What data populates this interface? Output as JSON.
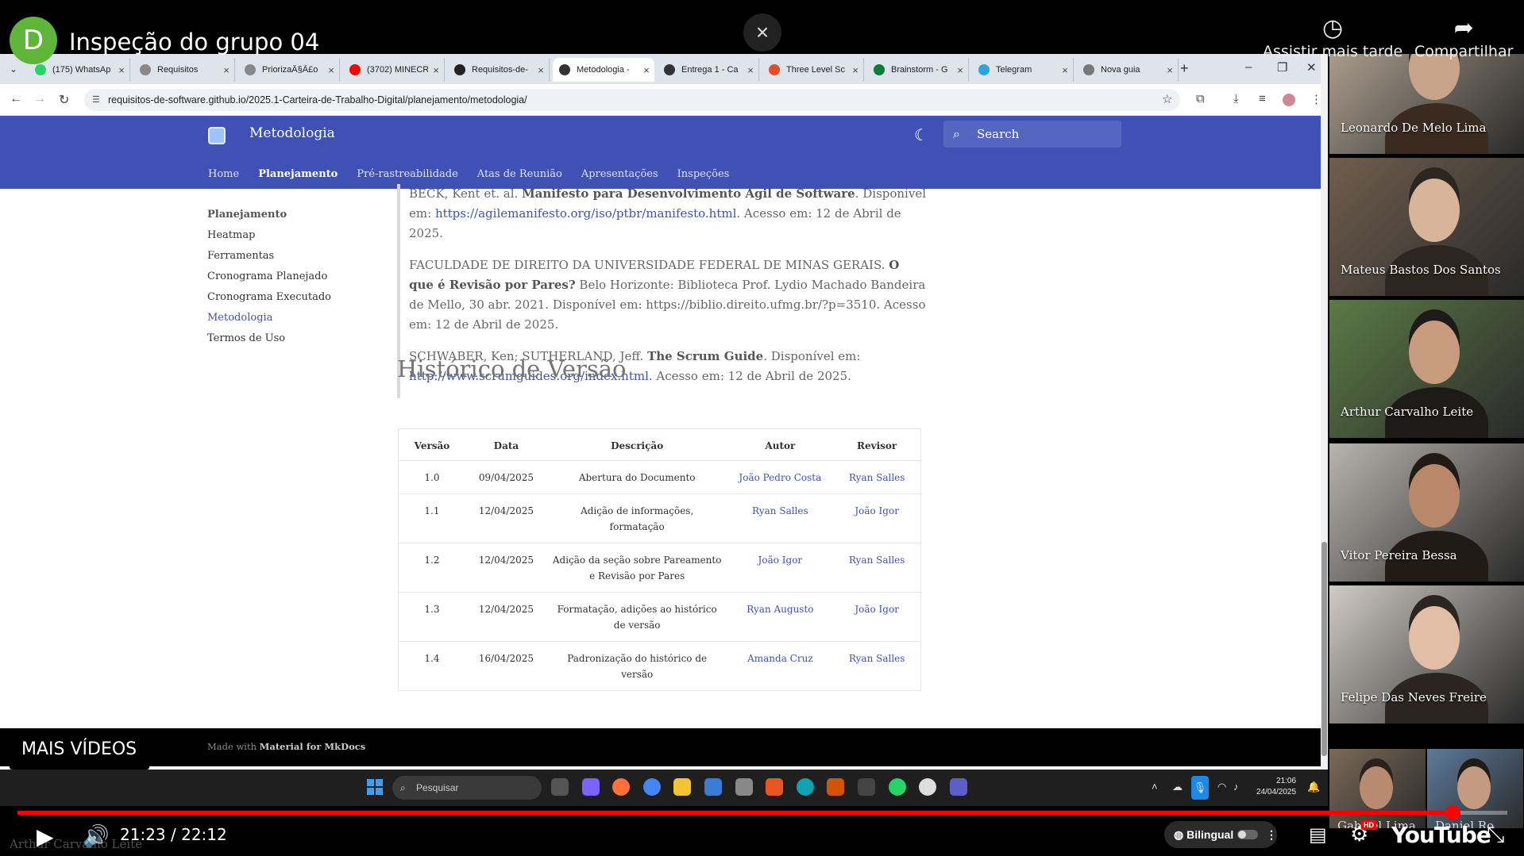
{
  "video": {
    "channel_initial": "D",
    "title": "Inspeção do grupo 04",
    "close_icon": "×",
    "watch_later": "Assistir mais tarde",
    "share": "Compartilhar",
    "more_videos": "MAIS VÍDEOS",
    "time": "21:23 / 22:12",
    "progress_fraction": 0.9632,
    "caption_overlay": "Arthur Carvalho Leite",
    "bilingual_label": "Bilingual",
    "logo": "YouTube",
    "hd_badge": "HD"
  },
  "browser": {
    "tabs": [
      {
        "label": "(175) WhatsAp",
        "color": "#25d366"
      },
      {
        "label": "Requisitos",
        "color": "#888888"
      },
      {
        "label": "PriorizaÃ§Ã£o",
        "color": "#888888"
      },
      {
        "label": "(3702) MINECR",
        "color": "#ff0000"
      },
      {
        "label": "Requisitos-de-",
        "color": "#222222"
      },
      {
        "label": "Metodologia -",
        "color": "#333333",
        "active": true
      },
      {
        "label": "Entrega 1 - Ca",
        "color": "#333333"
      },
      {
        "label": "Three Level Sc",
        "color": "#e44d26"
      },
      {
        "label": "Brainstorm - G",
        "color": "#0a7d3b"
      },
      {
        "label": "Telegram",
        "color": "#2aa3e0"
      },
      {
        "label": "Nova guia",
        "color": "#777777"
      }
    ],
    "url": "requisitos-de-software.github.io/2025.1-Carteira-de-Trabalho-Digital/planejamento/metodologia/"
  },
  "site": {
    "title": "Metodologia",
    "search_placeholder": "Search",
    "tabs": [
      "Home",
      "Planejamento",
      "Pré-rastreabilidade",
      "Atas de Reunião",
      "Apresentações",
      "Inspeções"
    ],
    "sidebar": {
      "heading": "Planejamento",
      "items": [
        "Heatmap",
        "Ferramentas",
        "Cronograma Planejado",
        "Cronograma Executado",
        "Metodologia",
        "Termos de Uso"
      ]
    },
    "references": {
      "r1_a": "BECK, Kent et. al.",
      "r1_b": "Manifesto para Desenvolvimento Ágil de Software",
      "r1_c": ". Disponível em:",
      "r1_link": "https://agilemanifesto.org/iso/ptbr/manifesto.html",
      "r1_d": ". Acesso em: 12 de Abril de 2025.",
      "r2_a": "FACULDADE DE DIREITO DA UNIVERSIDADE FEDERAL DE MINAS GERAIS.",
      "r2_b": "O que é Revisão por Pares?",
      "r2_c": "Belo Horizonte: Biblioteca Prof. Lydio Machado Bandeira de Mello, 30 abr. 2021. Disponível em: https://biblio.direito.ufmg.br/?p=3510. Acesso em: 12 de Abril de 2025.",
      "r3_a": "SCHWABER, Ken; SUTHERLAND, Jeff.",
      "r3_b": "The Scrum Guide",
      "r3_c": ". Disponível em:",
      "r3_link": "http://www.scrumguides.org/index.html",
      "r3_d": ". Acesso em: 12 de Abril de 2025."
    },
    "history_title": "Histórico de Versão",
    "history_table": {
      "headers": [
        "Versão",
        "Data",
        "Descrição",
        "Autor",
        "Revisor"
      ],
      "rows": [
        [
          "1.0",
          "09/04/2025",
          "Abertura do Documento",
          "João Pedro Costa",
          "Ryan Salles"
        ],
        [
          "1.1",
          "12/04/2025",
          "Adição de informações, formatação",
          "Ryan Salles",
          "João Igor"
        ],
        [
          "1.2",
          "12/04/2025",
          "Adição da seção sobre Pareamento e Revisão por Pares",
          "João Igor",
          "Ryan Salles"
        ],
        [
          "1.3",
          "12/04/2025",
          "Formatação, adições ao histórico de versão",
          "Ryan Augusto",
          "João Igor"
        ],
        [
          "1.4",
          "16/04/2025",
          "Padronização do histórico de versão",
          "Amanda Cruz",
          "Ryan Salles"
        ]
      ]
    },
    "footer_prefix": "Made with",
    "footer_brand": "Material for MkDocs"
  },
  "taskbar": {
    "search_placeholder": "Pesquisar",
    "time": "21:06",
    "date": "24/04/2025"
  },
  "participants": [
    {
      "name": "Leonardo De Melo Lima",
      "bg": "#b9aa98",
      "face": "#c8a58a",
      "hair": "#3a2a20"
    },
    {
      "name": "Mateus Bastos Dos Santos",
      "bg": "#6f5e4d",
      "face": "#d7b49a",
      "hair": "#2d2520"
    },
    {
      "name": "Arthur Carvalho Leite",
      "bg": "#5b7a45",
      "face": "#c89b7e",
      "hair": "#1e1a18"
    },
    {
      "name": "Vitor Pereira Bessa",
      "bg": "#b8b4ae",
      "face": "#b9886a",
      "hair": "#221a15"
    },
    {
      "name": "Felipe Das Neves Freire",
      "bg": "#cfcac4",
      "face": "#e1bea5",
      "hair": "#2b2420"
    },
    {
      "name": "Gabriel Lima",
      "bg": "#7b6a58",
      "face": "#b88b70",
      "hair": "#2a211c"
    },
    {
      "name": "Daniel Ro...",
      "bg": "#5d7a9a",
      "face": "#c49a80",
      "hair": "#1f1b18"
    }
  ]
}
